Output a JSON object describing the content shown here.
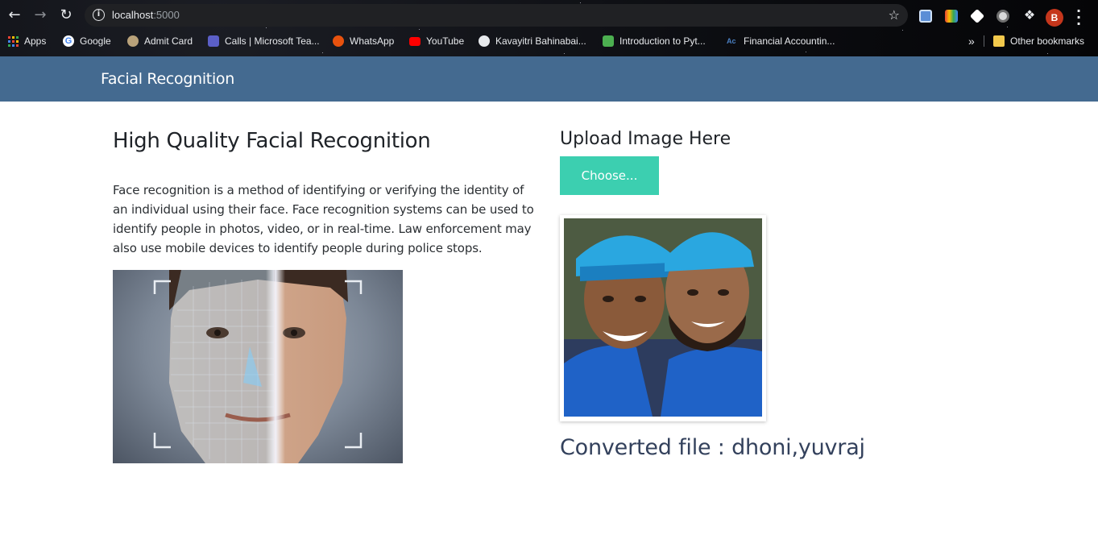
{
  "browser": {
    "url_host": "localhost",
    "url_port": ":5000",
    "profile_initial": "B",
    "bookmarks": [
      {
        "label": "Apps",
        "icon": "apps-grid-icon"
      },
      {
        "label": "Google",
        "icon": "google-icon"
      },
      {
        "label": "Admit Card",
        "icon": "admit-card-icon"
      },
      {
        "label": "Calls | Microsoft Tea...",
        "icon": "teams-icon"
      },
      {
        "label": "WhatsApp",
        "icon": "whatsapp-icon"
      },
      {
        "label": "YouTube",
        "icon": "youtube-icon"
      },
      {
        "label": "Kavayitri Bahinabai...",
        "icon": "globe-icon"
      },
      {
        "label": "Introduction to Pyt...",
        "icon": "w3-icon"
      },
      {
        "label": "Financial Accountin...",
        "icon": "ac-icon"
      }
    ],
    "overflow_label": "»",
    "other_bookmarks": "Other bookmarks"
  },
  "navbar": {
    "brand": "Facial Recognition"
  },
  "left": {
    "title": "High Quality Facial Recognition",
    "description": "Face recognition is a method of identifying or verifying the identity of an individual using their face. Face recognition systems can be used to identify people in photos, video, or in real-time. Law enforcement may also use mobile devices to identify people during police stops."
  },
  "right": {
    "upload_title": "Upload Image Here",
    "choose_label": "Choose...",
    "result_text": "Converted file : dhoni,yuvraj"
  },
  "colors": {
    "navbar": "#446a90",
    "button": "#3ccfb0",
    "result_text": "#33415c"
  }
}
